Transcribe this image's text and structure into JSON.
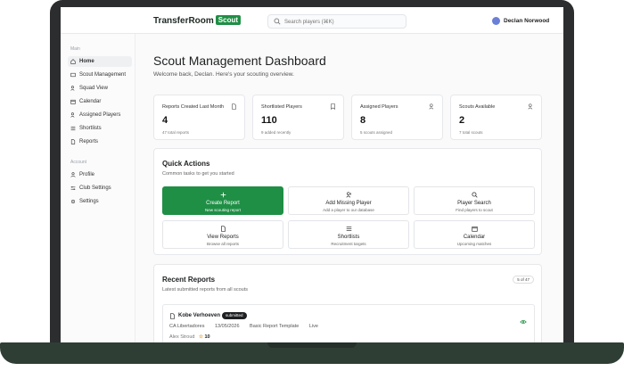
{
  "header": {
    "brand": "TransferRoom",
    "brand_badge": "Scout",
    "search_placeholder": "Search players (⌘K)",
    "user_name": "Declan Norwood"
  },
  "sidebar": {
    "main_label": "Main",
    "main_items": [
      {
        "label": "Home",
        "icon": "home-icon",
        "active": true
      },
      {
        "label": "Scout Management",
        "icon": "scout-icon"
      },
      {
        "label": "Squad View",
        "icon": "users-icon"
      },
      {
        "label": "Calendar",
        "icon": "calendar-icon"
      },
      {
        "label": "Assigned Players",
        "icon": "user-check-icon"
      },
      {
        "label": "Shortlists",
        "icon": "list-icon"
      },
      {
        "label": "Reports",
        "icon": "file-icon"
      }
    ],
    "account_label": "Account",
    "account_items": [
      {
        "label": "Profile",
        "icon": "user-icon"
      },
      {
        "label": "Club Settings",
        "icon": "sliders-icon"
      },
      {
        "label": "Settings",
        "icon": "gear-icon"
      }
    ]
  },
  "page": {
    "title": "Scout Management Dashboard",
    "subtitle": "Welcome back, Declan. Here's your scouting overview."
  },
  "stats": [
    {
      "title": "Reports Created Last Month",
      "value": "4",
      "sub": "47 total reports",
      "icon": "file-icon"
    },
    {
      "title": "Shortlisted Players",
      "value": "110",
      "sub": "9 added recently",
      "icon": "bookmark-icon"
    },
    {
      "title": "Assigned Players",
      "value": "8",
      "sub": "5 scouts assigned",
      "icon": "user-check-icon"
    },
    {
      "title": "Scouts Available",
      "value": "2",
      "sub": "7 total scouts",
      "icon": "users-icon"
    }
  ],
  "quick_actions": {
    "title": "Quick Actions",
    "subtitle": "Common tasks to get you started",
    "items": [
      {
        "label": "Create Report",
        "desc": "New scouting report",
        "icon": "plus-icon",
        "primary": true
      },
      {
        "label": "Add Missing Player",
        "desc": "Add a player to our database",
        "icon": "user-plus-icon"
      },
      {
        "label": "Player Search",
        "desc": "Find players to scout",
        "icon": "search-icon"
      },
      {
        "label": "View Reports",
        "desc": "Browse all reports",
        "icon": "file-icon"
      },
      {
        "label": "Shortlists",
        "desc": "Recruitment targets",
        "icon": "list-icon"
      },
      {
        "label": "Calendar",
        "desc": "Upcoming matches",
        "icon": "calendar-icon"
      }
    ]
  },
  "recent_reports": {
    "title": "Recent Reports",
    "subtitle": "Latest submitted reports from all scouts",
    "count_badge": "5 of 47",
    "items": [
      {
        "player": "Kobe Verhoeven",
        "status": "submitted",
        "club": "CA Libertadores",
        "date": "13/05/2026",
        "template": "Basic Report Template",
        "match_type": "Live",
        "scout": "Alex Stroud",
        "rating": "10"
      }
    ]
  },
  "colors": {
    "accent": "#1f8f45",
    "frame": "#2b2d2f",
    "base": "#2f3e35"
  }
}
